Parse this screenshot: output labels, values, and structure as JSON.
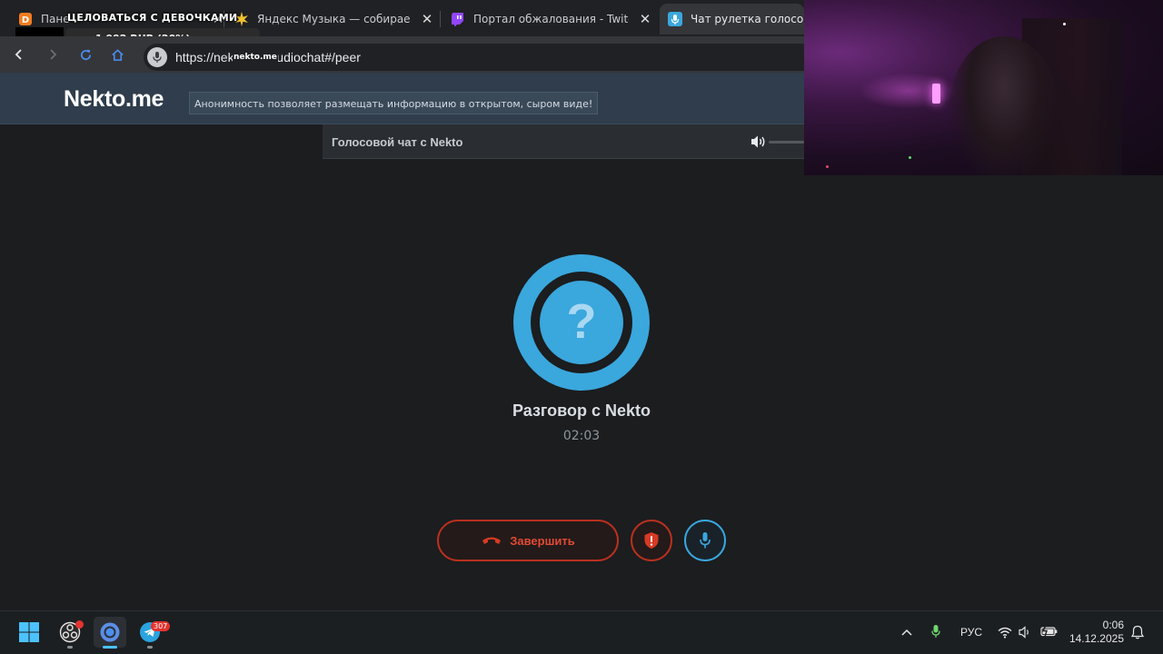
{
  "browser": {
    "tabs": [
      {
        "title": "Пане",
        "favicon": "donationalerts-icon",
        "active": false
      },
      {
        "title": "Яндекс Музыка — собираем",
        "favicon": "yandex-music-icon",
        "active": false
      },
      {
        "title": "Портал обжалования - Twitch",
        "favicon": "twitch-icon",
        "active": false
      },
      {
        "title": "Чат рулетка голосовая",
        "favicon": "nekto-mic-icon",
        "active": true
      }
    ],
    "close_glyph": "✕",
    "url": "https://nekto.me/audiochat#/peer"
  },
  "stream_overlay": {
    "title": "ЦЕЛОВАТЬСЯ С ДЕВОЧКАМИ",
    "donation": "1 992 RUB (20%)",
    "url_overlay": "nekto.me"
  },
  "site": {
    "logo": "Nekto.me",
    "tagline": "Анонимность позволяет размещать информацию в открытом, сыром виде!",
    "chat_title": "Голосовой чат с Nekto"
  },
  "call": {
    "avatar_glyph": "?",
    "peer_name": "Разговор с Nekto",
    "timer": "02:03",
    "end_label": "Завершить"
  },
  "taskbar": {
    "telegram_badge": "307",
    "tray_language": "РУС",
    "time": "0:06",
    "date": "14.12.2025"
  },
  "colors": {
    "accent_blue": "#3aa7dd",
    "danger_red": "#d63a24",
    "header_bg": "#2f3d4c",
    "page_bg": "#1b1d1f"
  }
}
